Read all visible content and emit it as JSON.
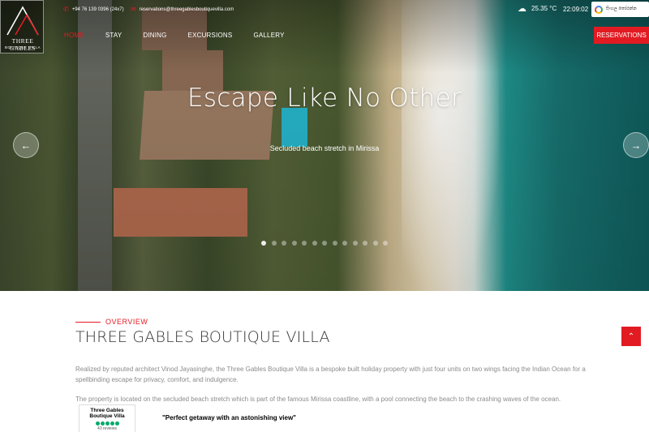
{
  "brand": {
    "name": "THREE GABLES",
    "subtitle": "BOUTIQUE VILLA"
  },
  "topbar": {
    "phone": "+94 76 139 0396 (24x7)",
    "email": "reservations@threegablesboutiquevilla.com",
    "temperature": "25.35 °C",
    "time": "22:09:02",
    "translate_label": "සිංහල තෝරන්න",
    "weather_icon": "cloud-moon-icon"
  },
  "nav": {
    "items": [
      {
        "label": "HOME",
        "active": true
      },
      {
        "label": "STAY"
      },
      {
        "label": "DINING"
      },
      {
        "label": "EXCURSIONS"
      },
      {
        "label": "GALLERY"
      }
    ],
    "reservations_label": "RESERVATIONS"
  },
  "hero": {
    "headline": "Escape Like No Other",
    "subline": "Secluded beach stretch in Mirissa",
    "slide_count": 13,
    "active_slide": 1
  },
  "overview": {
    "label": "OVERVIEW",
    "title": "THREE GABLES BOUTIQUE VILLA",
    "paragraph1": "Realized by reputed architect Vinod Jayasinghe, the Three Gables Boutique Villa is a bespoke built holiday property with just four units on two wings facing the Indian Ocean for a spellbinding escape for privacy, comfort, and indulgence.",
    "paragraph2": "The property is located on the secluded beach stretch which is part of the famous Mirissa coastline, with a pool connecting the beach to the crashing waves of the ocean."
  },
  "review": {
    "name": "Three Gables Boutique Villa",
    "count": "43 reviews",
    "rating": 5,
    "quote": "\"Perfect getaway with an astonishing view\""
  },
  "colors": {
    "accent": "#e21b22",
    "text": "#333333",
    "muted": "#8b8b8b",
    "rating": "#00aa6c"
  }
}
